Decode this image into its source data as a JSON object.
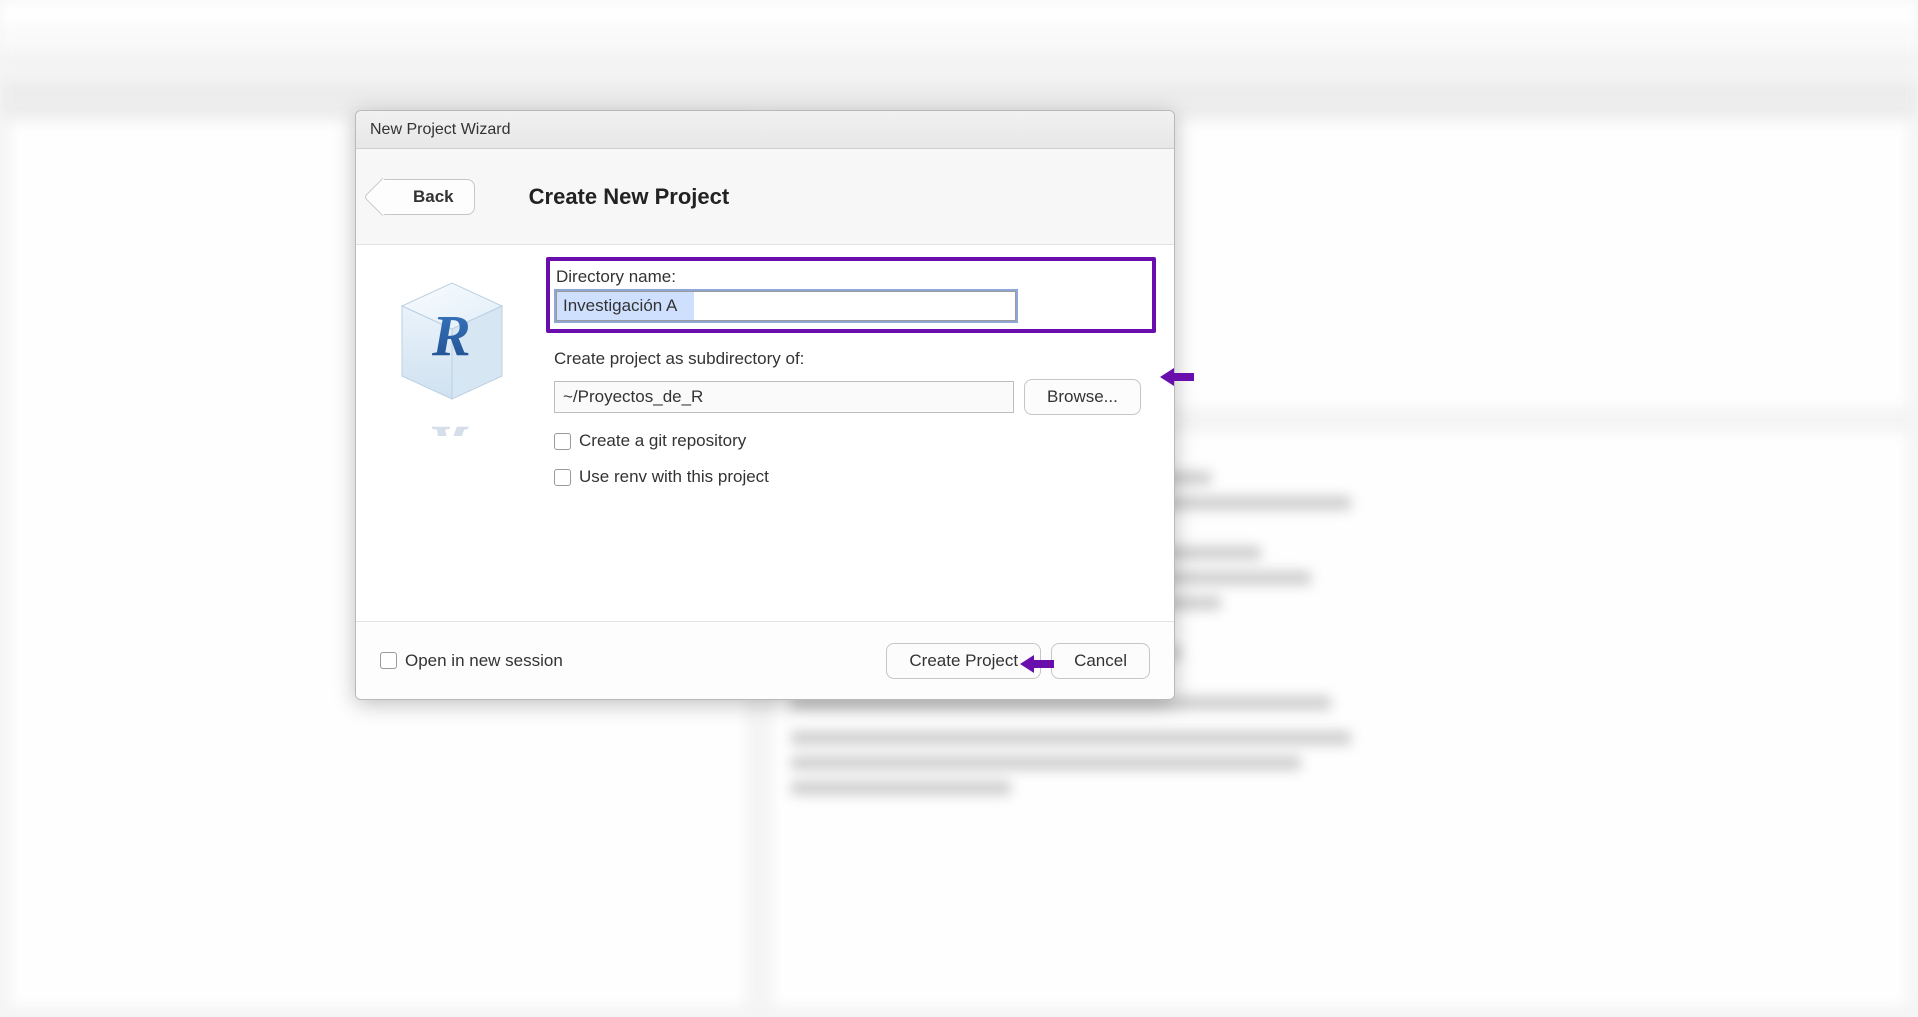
{
  "dialog": {
    "title": "New Project Wizard",
    "back_label": "Back",
    "heading": "Create New Project",
    "dir_name_label": "Directory name:",
    "dir_name_value": "Investigación A",
    "subdir_label": "Create project as subdirectory of:",
    "subdir_value": "~/Proyectos_de_R",
    "browse_label": "Browse...",
    "git_checkbox_label": "Create a git repository",
    "renv_checkbox_label": "Use renv with this project",
    "open_new_session_label": "Open in new session",
    "create_label": "Create Project",
    "cancel_label": "Cancel"
  },
  "annotation": {
    "arrow_color": "#6a0dad"
  }
}
